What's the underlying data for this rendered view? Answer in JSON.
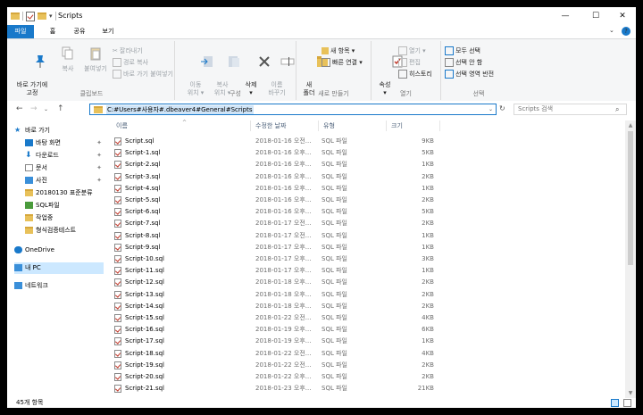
{
  "window": {
    "title": "Scripts",
    "controls": {
      "minimize": "—",
      "maximize": "☐",
      "close": "✕"
    }
  },
  "ribbon_tabs": [
    "파일",
    "홈",
    "공유",
    "보기"
  ],
  "ribbon": {
    "clipboard": {
      "pin_label": "바로 가기에\n고정",
      "copy_label": "복사",
      "paste_label": "붙여넣기",
      "cut_label": "잘라내기",
      "copy_path_label": "경로 복사",
      "paste_shortcut_label": "바로 가기 붙여넣기",
      "group_label": "클립보드"
    },
    "organize": {
      "move_label": "이동\n위치 ▾",
      "copy_to_label": "복사\n위치 ▾",
      "delete_label": "삭제\n▾",
      "rename_label": "이름\n바꾸기",
      "group_label": "구성"
    },
    "new": {
      "new_folder_label": "새\n폴더",
      "new_item_label": "새 항목 ▾",
      "easy_access_label": "빠른 연결 ▾",
      "group_label": "새로 만들기"
    },
    "open": {
      "properties_label": "속성\n▾",
      "open_label": "열기 ▾",
      "edit_label": "편집",
      "history_label": "히스토리",
      "group_label": "열기"
    },
    "select": {
      "select_all_label": "모두 선택",
      "select_none_label": "선택 안 함",
      "invert_label": "선택 영역 반전",
      "group_label": "선택"
    }
  },
  "address": {
    "path": "C:#Users#사용자#.dbeaver4#General#Scripts",
    "search_placeholder": "Scripts 검색"
  },
  "nav_pane": [
    {
      "label": "바로 가기",
      "icon": "star-icon",
      "pinned": false
    },
    {
      "label": "바탕 화면",
      "icon": "desktop-icon",
      "pinned": true
    },
    {
      "label": "다운로드",
      "icon": "download-icon",
      "pinned": true
    },
    {
      "label": "문서",
      "icon": "document-icon",
      "pinned": true
    },
    {
      "label": "사진",
      "icon": "pictures-icon",
      "pinned": true
    },
    {
      "label": "20180130 표준분류",
      "icon": "folder-icon",
      "pinned": false
    },
    {
      "label": "SQL파일",
      "icon": "sql-folder-icon",
      "pinned": false
    },
    {
      "label": "작업중",
      "icon": "folder-icon",
      "pinned": false
    },
    {
      "label": "형식검증테스트",
      "icon": "folder-icon",
      "pinned": false
    },
    {
      "label": "OneDrive",
      "icon": "cloud-icon",
      "pinned": false
    },
    {
      "label": "내 PC",
      "icon": "pc-icon",
      "pinned": false
    },
    {
      "label": "네트워크",
      "icon": "network-icon",
      "pinned": false
    }
  ],
  "columns": {
    "name": "이름",
    "date": "수정한 날짜",
    "type": "유형",
    "size": "크기"
  },
  "files": [
    {
      "name": "Script.sql",
      "date": "2018-01-16 오전...",
      "type": "SQL 파일",
      "size": "9KB"
    },
    {
      "name": "Script-1.sql",
      "date": "2018-01-16 오후...",
      "type": "SQL 파일",
      "size": "5KB"
    },
    {
      "name": "Script-2.sql",
      "date": "2018-01-16 오후...",
      "type": "SQL 파일",
      "size": "1KB"
    },
    {
      "name": "Script-3.sql",
      "date": "2018-01-16 오후...",
      "type": "SQL 파일",
      "size": "2KB"
    },
    {
      "name": "Script-4.sql",
      "date": "2018-01-16 오후...",
      "type": "SQL 파일",
      "size": "1KB"
    },
    {
      "name": "Script-5.sql",
      "date": "2018-01-16 오후...",
      "type": "SQL 파일",
      "size": "2KB"
    },
    {
      "name": "Script-6.sql",
      "date": "2018-01-16 오후...",
      "type": "SQL 파일",
      "size": "5KB"
    },
    {
      "name": "Script-7.sql",
      "date": "2018-01-17 오전...",
      "type": "SQL 파일",
      "size": "2KB"
    },
    {
      "name": "Script-8.sql",
      "date": "2018-01-17 오전...",
      "type": "SQL 파일",
      "size": "1KB"
    },
    {
      "name": "Script-9.sql",
      "date": "2018-01-17 오후...",
      "type": "SQL 파일",
      "size": "1KB"
    },
    {
      "name": "Script-10.sql",
      "date": "2018-01-17 오후...",
      "type": "SQL 파일",
      "size": "3KB"
    },
    {
      "name": "Script-11.sql",
      "date": "2018-01-17 오후...",
      "type": "SQL 파일",
      "size": "1KB"
    },
    {
      "name": "Script-12.sql",
      "date": "2018-01-18 오후...",
      "type": "SQL 파일",
      "size": "2KB"
    },
    {
      "name": "Script-13.sql",
      "date": "2018-01-18 오후...",
      "type": "SQL 파일",
      "size": "2KB"
    },
    {
      "name": "Script-14.sql",
      "date": "2018-01-18 오후...",
      "type": "SQL 파일",
      "size": "2KB"
    },
    {
      "name": "Script-15.sql",
      "date": "2018-01-22 오전...",
      "type": "SQL 파일",
      "size": "4KB"
    },
    {
      "name": "Script-16.sql",
      "date": "2018-01-19 오후...",
      "type": "SQL 파일",
      "size": "6KB"
    },
    {
      "name": "Script-17.sql",
      "date": "2018-01-19 오후...",
      "type": "SQL 파일",
      "size": "1KB"
    },
    {
      "name": "Script-18.sql",
      "date": "2018-01-22 오전...",
      "type": "SQL 파일",
      "size": "4KB"
    },
    {
      "name": "Script-19.sql",
      "date": "2018-01-22 오전...",
      "type": "SQL 파일",
      "size": "2KB"
    },
    {
      "name": "Script-20.sql",
      "date": "2018-01-22 오후...",
      "type": "SQL 파일",
      "size": "2KB"
    },
    {
      "name": "Script-21.sql",
      "date": "2018-01-23 오후...",
      "type": "SQL 파일",
      "size": "21KB"
    }
  ],
  "status": {
    "count": "45개 항목"
  },
  "colors": {
    "accent": "#1979ca",
    "selection": "#cce8ff",
    "folder": "#e8c15a"
  }
}
